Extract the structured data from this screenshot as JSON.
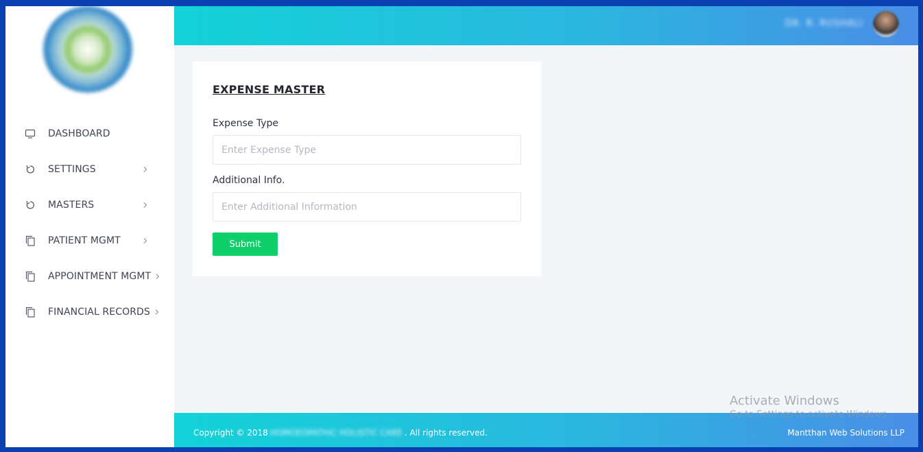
{
  "sidebar": {
    "items": [
      {
        "label": "DASHBOARD",
        "icon": "monitor-icon",
        "has_submenu": false
      },
      {
        "label": "SETTINGS",
        "icon": "refresh-icon",
        "has_submenu": true
      },
      {
        "label": "MASTERS",
        "icon": "refresh-icon",
        "has_submenu": true
      },
      {
        "label": "PATIENT MGMT",
        "icon": "copy-icon",
        "has_submenu": true
      },
      {
        "label": "APPOINTMENT MGMT",
        "icon": "copy-icon",
        "has_submenu": true
      },
      {
        "label": "FINANCIAL RECORDS",
        "icon": "copy-icon",
        "has_submenu": true
      }
    ]
  },
  "header": {
    "user_name": "DR. R. RUSHALI"
  },
  "form": {
    "title": "EXPENSE MASTER",
    "expense_type_label": "Expense Type",
    "expense_type_placeholder": "Enter Expense Type",
    "additional_info_label": "Additional Info.",
    "additional_info_placeholder": "Enter Additional Information",
    "submit_label": "Submit"
  },
  "footer": {
    "copyright_prefix": "Copyright © 2018",
    "org_name": "HOMOEOPATHIC HOLISTIC CARE",
    "copyright_suffix": ". All rights reserved.",
    "company": "Mantthan Web Solutions LLP"
  },
  "watermark": {
    "title": "Activate Windows",
    "subtitle": "Go to Settings to activate Windows."
  },
  "colors": {
    "accent_start": "#13d3d8",
    "accent_end": "#4a8ee6",
    "submit": "#0fcf6a",
    "frame_border": "#0a3fb0"
  }
}
